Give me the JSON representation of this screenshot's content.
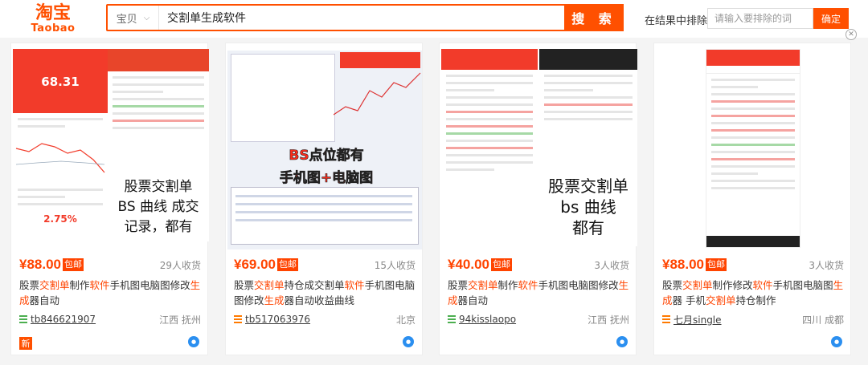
{
  "header": {
    "logo_cn": "淘宝",
    "logo_en": "Taobao",
    "search_scope": "宝贝",
    "search_query": "交割单生成软件",
    "search_button": "搜 索",
    "exclude_label": "在结果中排除",
    "exclude_placeholder": "请输入要排除的词",
    "confirm_button": "确定"
  },
  "colors": {
    "brand": "#ff5000",
    "price": "#ff4400"
  },
  "items": [
    {
      "price": "¥88.00",
      "post_badge": "包邮",
      "sold": "29人收货",
      "title": [
        {
          "t": "股票",
          "h": false
        },
        {
          "t": "交割单",
          "h": true
        },
        {
          "t": "制作",
          "h": false
        },
        {
          "t": "软件",
          "h": true
        },
        {
          "t": "手机图电脑图修改",
          "h": false
        },
        {
          "t": "生成",
          "h": true
        },
        {
          "t": "器自动",
          "h": false
        }
      ],
      "shop": "tb846621907",
      "location": "江西 抚州",
      "new_badge": "新",
      "image_text": {
        "value": "68.31",
        "big": "股票交割单\nBS 曲线 成交\n记录，都有",
        "pct": "2.75%"
      }
    },
    {
      "price": "¥69.00",
      "post_badge": "包邮",
      "sold": "15人收货",
      "title": [
        {
          "t": "股票",
          "h": false
        },
        {
          "t": "交割单",
          "h": true
        },
        {
          "t": "持仓成交割单",
          "h": false
        },
        {
          "t": "软件",
          "h": true
        },
        {
          "t": "手机图电脑图修改",
          "h": false
        },
        {
          "t": "生成",
          "h": true
        },
        {
          "t": "器自动收益曲线",
          "h": false
        }
      ],
      "shop": "tb517063976",
      "location": "北京",
      "image_text": {
        "line1": "BS点位都有",
        "line2": "手机图+电脑图"
      }
    },
    {
      "price": "¥40.00",
      "post_badge": "包邮",
      "sold": "3人收货",
      "title": [
        {
          "t": "股票",
          "h": false
        },
        {
          "t": "交割单",
          "h": true
        },
        {
          "t": "制作",
          "h": false
        },
        {
          "t": "软件",
          "h": true
        },
        {
          "t": "手机图电脑图修改",
          "h": false
        },
        {
          "t": "生成",
          "h": true
        },
        {
          "t": "器自动",
          "h": false
        }
      ],
      "shop": "94kisslaopo",
      "location": "江西 抚州",
      "image_text": {
        "big": "股票交割单\nbs 曲线\n都有"
      }
    },
    {
      "price": "¥88.00",
      "post_badge": "包邮",
      "sold": "3人收货",
      "title": [
        {
          "t": "股票",
          "h": false
        },
        {
          "t": "交割单",
          "h": true
        },
        {
          "t": "制作修改",
          "h": false
        },
        {
          "t": "软件",
          "h": true
        },
        {
          "t": "手机图电脑图",
          "h": false
        },
        {
          "t": "生成",
          "h": true
        },
        {
          "t": "器 手机",
          "h": false
        },
        {
          "t": "交割单",
          "h": true
        },
        {
          "t": "持仓制作",
          "h": false
        }
      ],
      "shop": "七月single",
      "location": "四川 成都"
    }
  ]
}
